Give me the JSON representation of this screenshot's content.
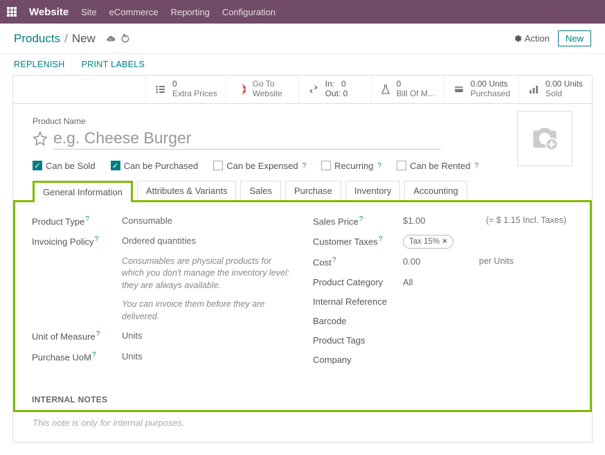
{
  "navbar": {
    "brand": "Website",
    "menu": [
      "Site",
      "eCommerce",
      "Reporting",
      "Configuration"
    ]
  },
  "breadcrumb": {
    "root": "Products",
    "current": "New"
  },
  "actions": {
    "action": "Action",
    "new": "New"
  },
  "subactions": {
    "replenish": "REPLENISH",
    "print_labels": "PRINT LABELS"
  },
  "stats": {
    "extra_prices": {
      "num": "0",
      "lbl": "Extra Prices"
    },
    "goto_website": {
      "l1": "Go To",
      "l2": "Website"
    },
    "inout": {
      "in_lbl": "In:",
      "in_val": "0",
      "out_lbl": "Out:",
      "out_val": "0"
    },
    "bom": {
      "num": "0",
      "lbl": "Bill Of M..."
    },
    "purchased": {
      "num": "0.00 Units",
      "lbl": "Purchased"
    },
    "sold": {
      "num": "0.00 Units",
      "lbl": "Sold"
    }
  },
  "title": {
    "label": "Product Name",
    "placeholder": "e.g. Cheese Burger"
  },
  "checks": {
    "sold": "Can be Sold",
    "purchased": "Can be Purchased",
    "expensed": "Can be Expensed",
    "recurring": "Recurring",
    "rented": "Can be Rented"
  },
  "tabs": {
    "general": "General Information",
    "attrs": "Attributes & Variants",
    "sales": "Sales",
    "purchase": "Purchase",
    "inventory": "Inventory",
    "accounting": "Accounting"
  },
  "form": {
    "product_type": {
      "label": "Product Type",
      "value": "Consumable"
    },
    "invoicing_policy": {
      "label": "Invoicing Policy",
      "value": "Ordered quantities"
    },
    "note1": "Consumables are physical products for which you don't manage the inventory level: they are always available.",
    "note2": "You can invoice them before they are delivered.",
    "uom": {
      "label": "Unit of Measure",
      "value": "Units"
    },
    "purchase_uom": {
      "label": "Purchase UoM",
      "value": "Units"
    },
    "sales_price": {
      "label": "Sales Price",
      "value": "$1.00",
      "extra": "(= $ 1.15 Incl. Taxes)"
    },
    "customer_taxes": {
      "label": "Customer Taxes",
      "tag": "Tax 15%"
    },
    "cost": {
      "label": "Cost",
      "value": "0.00",
      "extra": "per Units"
    },
    "category": {
      "label": "Product Category",
      "value": "All"
    },
    "internal_ref": {
      "label": "Internal Reference"
    },
    "barcode": {
      "label": "Barcode"
    },
    "tags": {
      "label": "Product Tags"
    },
    "company": {
      "label": "Company"
    }
  },
  "internal_notes": {
    "title": "INTERNAL NOTES",
    "placeholder": "This note is only for internal purposes."
  }
}
